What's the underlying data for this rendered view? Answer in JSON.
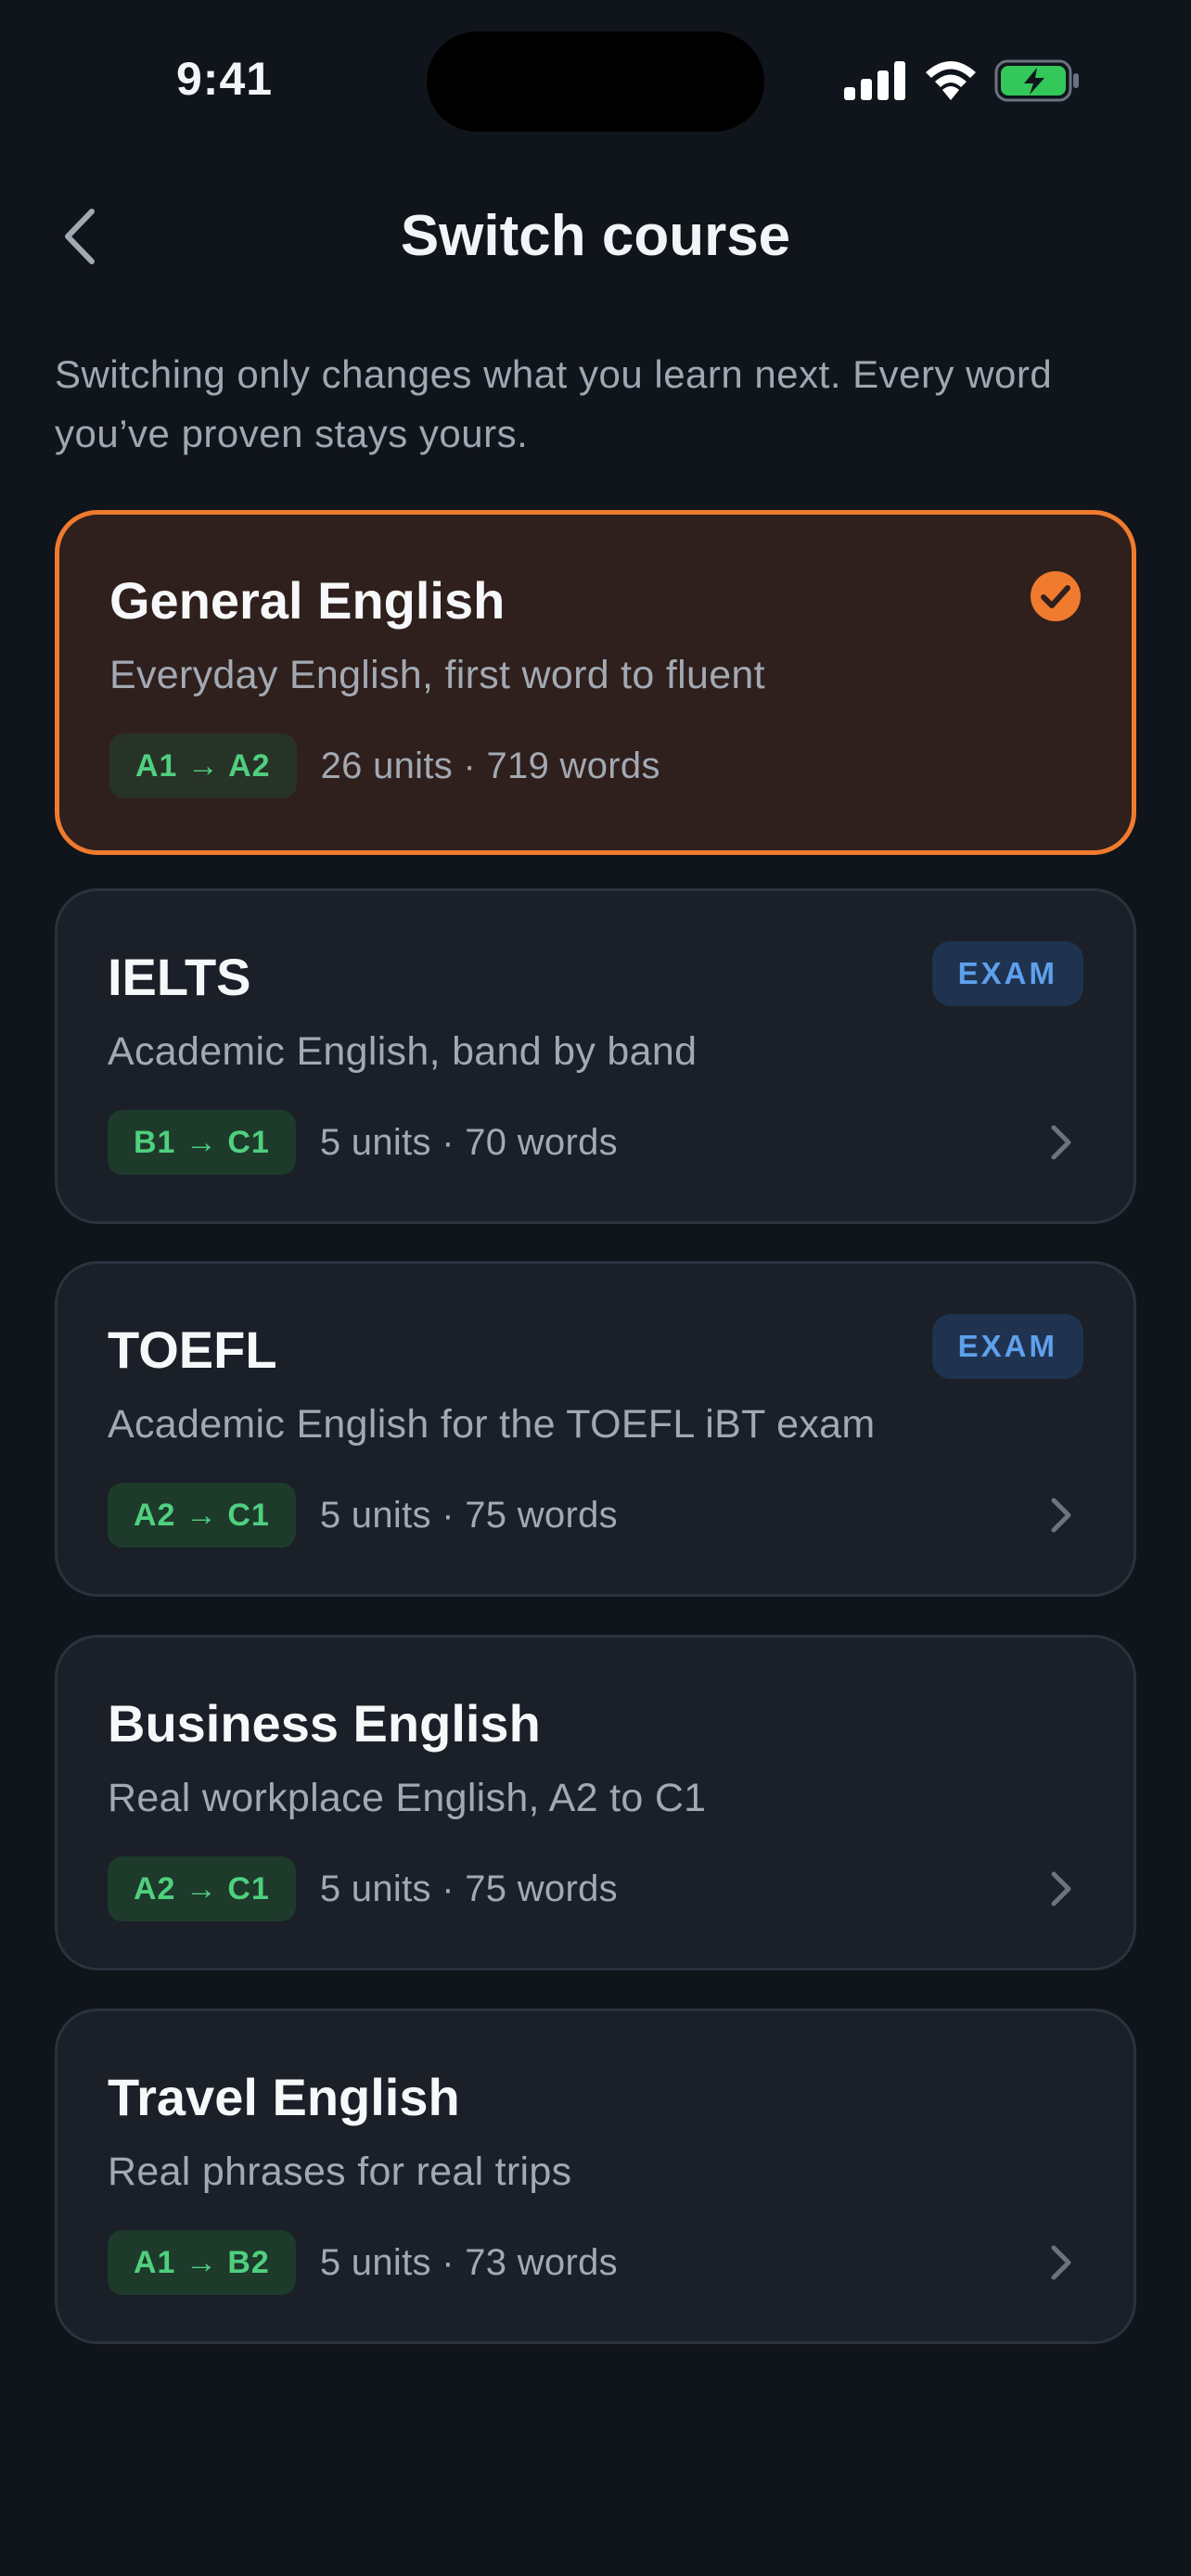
{
  "status_bar": {
    "time": "9:41"
  },
  "header": {
    "title": "Switch course"
  },
  "intro": "Switching only changes what you learn next. Every word you’ve proven stays yours.",
  "colors": {
    "accent": "#f07b2e",
    "level_green": "#4fd07f",
    "exam_blue": "#5ea0ec",
    "background": "#10141b"
  },
  "courses": [
    {
      "title": "General English",
      "subtitle": "Everyday English, first word to fluent",
      "level": "A1 → A2",
      "meta": "26 units · 719 words",
      "selected": true
    },
    {
      "title": "IELTS",
      "subtitle": "Academic English, band by band",
      "level": "B1 → C1",
      "meta": "5 units · 70 words",
      "badge": "EXAM"
    },
    {
      "title": "TOEFL",
      "subtitle": "Academic English for the TOEFL iBT exam",
      "level": "A2 → C1",
      "meta": "5 units · 75 words",
      "badge": "EXAM"
    },
    {
      "title": "Business English",
      "subtitle": "Real workplace English, A2 to C1",
      "level": "A2 → C1",
      "meta": "5 units · 75 words"
    },
    {
      "title": "Travel English",
      "subtitle": "Real phrases for real trips",
      "level": "A1 → B2",
      "meta": "5 units · 73 words"
    }
  ]
}
